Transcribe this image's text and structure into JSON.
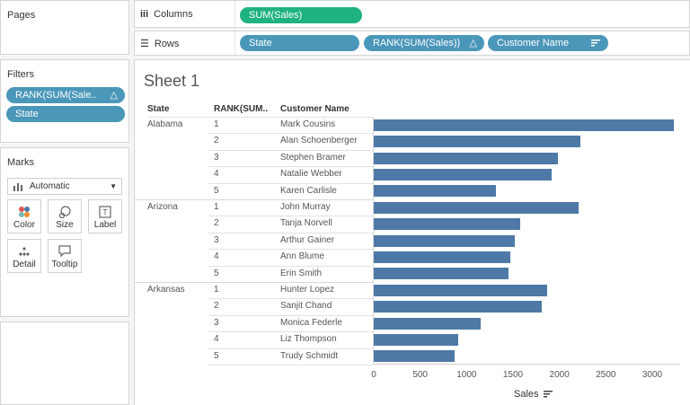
{
  "pages": {
    "title": "Pages"
  },
  "filters": {
    "title": "Filters",
    "items": [
      {
        "label": "RANK(SUM(Sale..",
        "icon": "delta-icon"
      },
      {
        "label": "State"
      }
    ]
  },
  "marks": {
    "title": "Marks",
    "type_label": "Automatic",
    "buttons": [
      {
        "label": "Color",
        "icon": "color-icon"
      },
      {
        "label": "Size",
        "icon": "size-icon"
      },
      {
        "label": "Label",
        "icon": "label-icon"
      },
      {
        "label": "Detail",
        "icon": "detail-icon"
      },
      {
        "label": "Tooltip",
        "icon": "tooltip-icon"
      }
    ]
  },
  "shelves": {
    "columns_label": "Columns",
    "rows_label": "Rows",
    "columns_pills": [
      "SUM(Sales)"
    ],
    "rows_pills": [
      "State",
      "RANK(SUM(Sales))",
      "Customer Name"
    ]
  },
  "sheet": {
    "title": "Sheet 1",
    "headers": {
      "state": "State",
      "rank": "RANK(SUM..",
      "customer": "Customer Name"
    },
    "axis_title": "Sales"
  },
  "chart_data": {
    "type": "bar",
    "orientation": "horizontal",
    "xlabel": "Sales",
    "xlim": [
      0,
      3300
    ],
    "xticks": [
      0,
      500,
      1000,
      1500,
      2000,
      2500,
      3000
    ],
    "groups": [
      {
        "state": "Alabama",
        "rows": [
          {
            "rank": "1",
            "customer": "Mark Cousins",
            "value": 3230
          },
          {
            "rank": "2",
            "customer": "Alan Schoenberger",
            "value": 2230
          },
          {
            "rank": "3",
            "customer": "Stephen Bramer",
            "value": 1980
          },
          {
            "rank": "4",
            "customer": "Natalie Webber",
            "value": 1920
          },
          {
            "rank": "5",
            "customer": "Karen Carlisle",
            "value": 1320
          }
        ]
      },
      {
        "state": "Arizona",
        "rows": [
          {
            "rank": "1",
            "customer": "John Murray",
            "value": 2210
          },
          {
            "rank": "2",
            "customer": "Tanja Norvell",
            "value": 1580
          },
          {
            "rank": "3",
            "customer": "Arthur Gainer",
            "value": 1520
          },
          {
            "rank": "4",
            "customer": "Ann Blume",
            "value": 1470
          },
          {
            "rank": "5",
            "customer": "Erin Smith",
            "value": 1450
          }
        ]
      },
      {
        "state": "Arkansas",
        "rows": [
          {
            "rank": "1",
            "customer": "Hunter Lopez",
            "value": 1870
          },
          {
            "rank": "2",
            "customer": "Sanjit Chand",
            "value": 1810
          },
          {
            "rank": "3",
            "customer": "Monica Federle",
            "value": 1150
          },
          {
            "rank": "4",
            "customer": "Liz Thompson",
            "value": 910
          },
          {
            "rank": "5",
            "customer": "Trudy Schmidt",
            "value": 870
          }
        ]
      }
    ],
    "bar_color": "#4e79a7"
  }
}
